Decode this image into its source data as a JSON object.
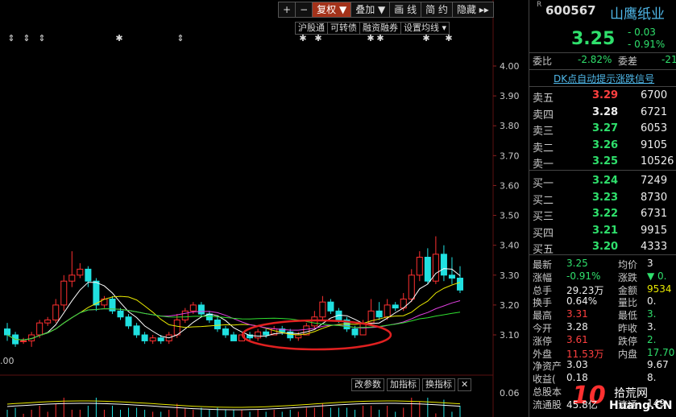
{
  "toolbar": {
    "plus": "+",
    "minus": "−",
    "fuquan": "复权",
    "fuquan_arrow": "▼",
    "diejia": "叠加",
    "diejia_arrow": "▼",
    "huaxian": "画 线",
    "jianyue": "简 约",
    "yincang": "隐藏",
    "nav": "▸▸"
  },
  "subbar": {
    "hugutong": "沪股通",
    "kezhuanzhai": "可转债",
    "rongzi": "融资融券",
    "junxian": "设置均线",
    "junxian_arrow": "▾"
  },
  "indicator_bar": {
    "gaicanshu": "改参数",
    "jiazhibiao": "加指标",
    "huanzhibiao": "换指标",
    "close": "✕"
  },
  "chart_data": {
    "type": "candlestick",
    "y_ticks": [
      "4.00",
      "3.90",
      "3.80",
      "3.70",
      "3.60",
      "3.50",
      "3.40",
      "3.30",
      "3.20",
      "3.10"
    ],
    "ylim": [
      3.02,
      4.07
    ],
    "low_label": ".00",
    "volume_tick": "0.06",
    "candles": [
      [
        3.12,
        3.1,
        3.14,
        3.08
      ],
      [
        3.1,
        3.07,
        3.11,
        3.06
      ],
      [
        3.08,
        3.08,
        3.09,
        3.07
      ],
      [
        3.08,
        3.1,
        3.11,
        3.06
      ],
      [
        3.1,
        3.14,
        3.15,
        3.09
      ],
      [
        3.14,
        3.15,
        3.16,
        3.13
      ],
      [
        3.15,
        3.2,
        3.22,
        3.14
      ],
      [
        3.2,
        3.28,
        3.3,
        3.18
      ],
      [
        3.28,
        3.3,
        3.38,
        3.26
      ],
      [
        3.3,
        3.32,
        3.34,
        3.29
      ],
      [
        3.32,
        3.28,
        3.33,
        3.26
      ],
      [
        3.28,
        3.2,
        3.29,
        3.18
      ],
      [
        3.2,
        3.22,
        3.23,
        3.19
      ],
      [
        3.22,
        3.18,
        3.23,
        3.17
      ],
      [
        3.18,
        3.16,
        3.19,
        3.15
      ],
      [
        3.16,
        3.13,
        3.17,
        3.12
      ],
      [
        3.13,
        3.1,
        3.14,
        3.09
      ],
      [
        3.1,
        3.08,
        3.11,
        3.07
      ],
      [
        3.08,
        3.09,
        3.1,
        3.07
      ],
      [
        3.09,
        3.08,
        3.1,
        3.07
      ],
      [
        3.08,
        3.1,
        3.11,
        3.07
      ],
      [
        3.1,
        3.15,
        3.17,
        3.09
      ],
      [
        3.15,
        3.18,
        3.19,
        3.14
      ],
      [
        3.18,
        3.2,
        3.21,
        3.17
      ],
      [
        3.2,
        3.17,
        3.21,
        3.16
      ],
      [
        3.17,
        3.15,
        3.18,
        3.14
      ],
      [
        3.15,
        3.12,
        3.16,
        3.11
      ],
      [
        3.12,
        3.1,
        3.13,
        3.09
      ],
      [
        3.1,
        3.08,
        3.11,
        3.08
      ],
      [
        3.08,
        3.1,
        3.1,
        3.08
      ],
      [
        3.1,
        3.09,
        3.11,
        3.08
      ],
      [
        3.09,
        3.11,
        3.12,
        3.08
      ],
      [
        3.11,
        3.1,
        3.12,
        3.09
      ],
      [
        3.1,
        3.12,
        3.13,
        3.1
      ],
      [
        3.12,
        3.11,
        3.13,
        3.1
      ],
      [
        3.11,
        3.09,
        3.12,
        3.08
      ],
      [
        3.09,
        3.1,
        3.11,
        3.08
      ],
      [
        3.1,
        3.13,
        3.14,
        3.1
      ],
      [
        3.13,
        3.16,
        3.18,
        3.12
      ],
      [
        3.16,
        3.21,
        3.23,
        3.15
      ],
      [
        3.21,
        3.18,
        3.22,
        3.17
      ],
      [
        3.18,
        3.15,
        3.19,
        3.14
      ],
      [
        3.15,
        3.12,
        3.16,
        3.11
      ],
      [
        3.12,
        3.1,
        3.13,
        3.09
      ],
      [
        3.1,
        3.14,
        3.15,
        3.1
      ],
      [
        3.14,
        3.18,
        3.22,
        3.13
      ],
      [
        3.18,
        3.16,
        3.21,
        3.15
      ],
      [
        3.16,
        3.2,
        3.22,
        3.15
      ],
      [
        3.2,
        3.19,
        3.21,
        3.18
      ],
      [
        3.19,
        3.22,
        3.24,
        3.18
      ],
      [
        3.22,
        3.3,
        3.32,
        3.21
      ],
      [
        3.3,
        3.36,
        3.38,
        3.28
      ],
      [
        3.36,
        3.28,
        3.39,
        3.27
      ],
      [
        3.28,
        3.37,
        3.43,
        3.27
      ],
      [
        3.37,
        3.3,
        3.4,
        3.28
      ],
      [
        3.3,
        3.29,
        3.36,
        3.27
      ],
      [
        3.29,
        3.25,
        3.33,
        3.24
      ]
    ],
    "ma_colors": [
      "#ffffff",
      "#e8e800",
      "#e040e0",
      "#30e030"
    ],
    "ellipse_color": "#e02020"
  },
  "quote": {
    "code_prefix": "R",
    "code": "600567",
    "name": "山鹰纸业",
    "price": "3.25",
    "change": "- 0.03",
    "change_pct": "- 0.91%",
    "weibi_label": "委比",
    "weibi": "-2.82%",
    "weicha_label": "委差",
    "weicha": "-21",
    "dk_link": "DK点自动提示涨跌信号"
  },
  "order_book": {
    "sell": [
      {
        "label": "卖五",
        "price": "3.29",
        "vol": "6700",
        "color": "#ff4040"
      },
      {
        "label": "卖四",
        "price": "3.28",
        "vol": "6721",
        "color": "#eeeeee"
      },
      {
        "label": "卖三",
        "price": "3.27",
        "vol": "6053",
        "color": "#2fe06c"
      },
      {
        "label": "卖二",
        "price": "3.26",
        "vol": "9105",
        "color": "#2fe06c"
      },
      {
        "label": "卖一",
        "price": "3.25",
        "vol": "10526",
        "color": "#2fe06c"
      }
    ],
    "buy": [
      {
        "label": "买一",
        "price": "3.24",
        "vol": "7249",
        "color": "#2fe06c"
      },
      {
        "label": "买二",
        "price": "3.23",
        "vol": "8730",
        "color": "#2fe06c"
      },
      {
        "label": "买三",
        "price": "3.22",
        "vol": "6731",
        "color": "#2fe06c"
      },
      {
        "label": "买四",
        "price": "3.21",
        "vol": "9915",
        "color": "#2fe06c"
      },
      {
        "label": "买五",
        "price": "3.20",
        "vol": "4333",
        "color": "#2fe06c"
      }
    ]
  },
  "stats": [
    {
      "l1": "最新",
      "v1": "3.25",
      "c1": "#2fe06c",
      "l2": "均价",
      "v2": "3",
      "c2": "#eeeeee"
    },
    {
      "l1": "涨幅",
      "v1": "-0.91%",
      "c1": "#2fe06c",
      "l2": "涨跌",
      "v2": "▼ 0.",
      "c2": "#2fe06c"
    },
    {
      "l1": "总手",
      "v1": "29.23万",
      "c1": "#eeeeee",
      "l2": "金额",
      "v2": "9534",
      "c2": "#e8e800"
    },
    {
      "l1": "换手",
      "v1": "0.64%",
      "c1": "#eeeeee",
      "l2": "量比",
      "v2": "0.",
      "c2": "#eeeeee"
    },
    {
      "l1": "最高",
      "v1": "3.31",
      "c1": "#ff4040",
      "l2": "最低",
      "v2": "3.",
      "c2": "#2fe06c"
    },
    {
      "l1": "今开",
      "v1": "3.28",
      "c1": "#eeeeee",
      "l2": "昨收",
      "v2": "3.",
      "c2": "#eeeeee"
    },
    {
      "l1": "涨停",
      "v1": "3.61",
      "c1": "#ff4040",
      "l2": "跌停",
      "v2": "2.",
      "c2": "#2fe06c"
    },
    {
      "l1": "外盘",
      "v1": "11.53万",
      "c1": "#ff4040",
      "l2": "内盘",
      "v2": "17.70",
      "c2": "#2fe06c"
    },
    {
      "l1": "净资产",
      "v1": "3.03",
      "c1": "#eeeeee",
      "l2": "",
      "v2": "9.67",
      "c2": "#eeeeee"
    },
    {
      "l1": "收益(",
      "v1": "0.18",
      "c1": "#eeeeee",
      "l2": "",
      "v2": "8.",
      "c2": "#eeeeee"
    },
    {
      "l1": "总股本",
      "v1": "",
      "c1": "#eeeeee",
      "l2": "",
      "v2": "",
      "c2": "#eeeeee"
    },
    {
      "l1": "流通股",
      "v1": "45.8亿",
      "c1": "#eeeeee",
      "l2": "流通",
      "v2": "149",
      "c2": "#eeeeee"
    }
  ],
  "watermark": {
    "num": "10",
    "text": "Huang.CN",
    "sub": "拾荒网"
  }
}
